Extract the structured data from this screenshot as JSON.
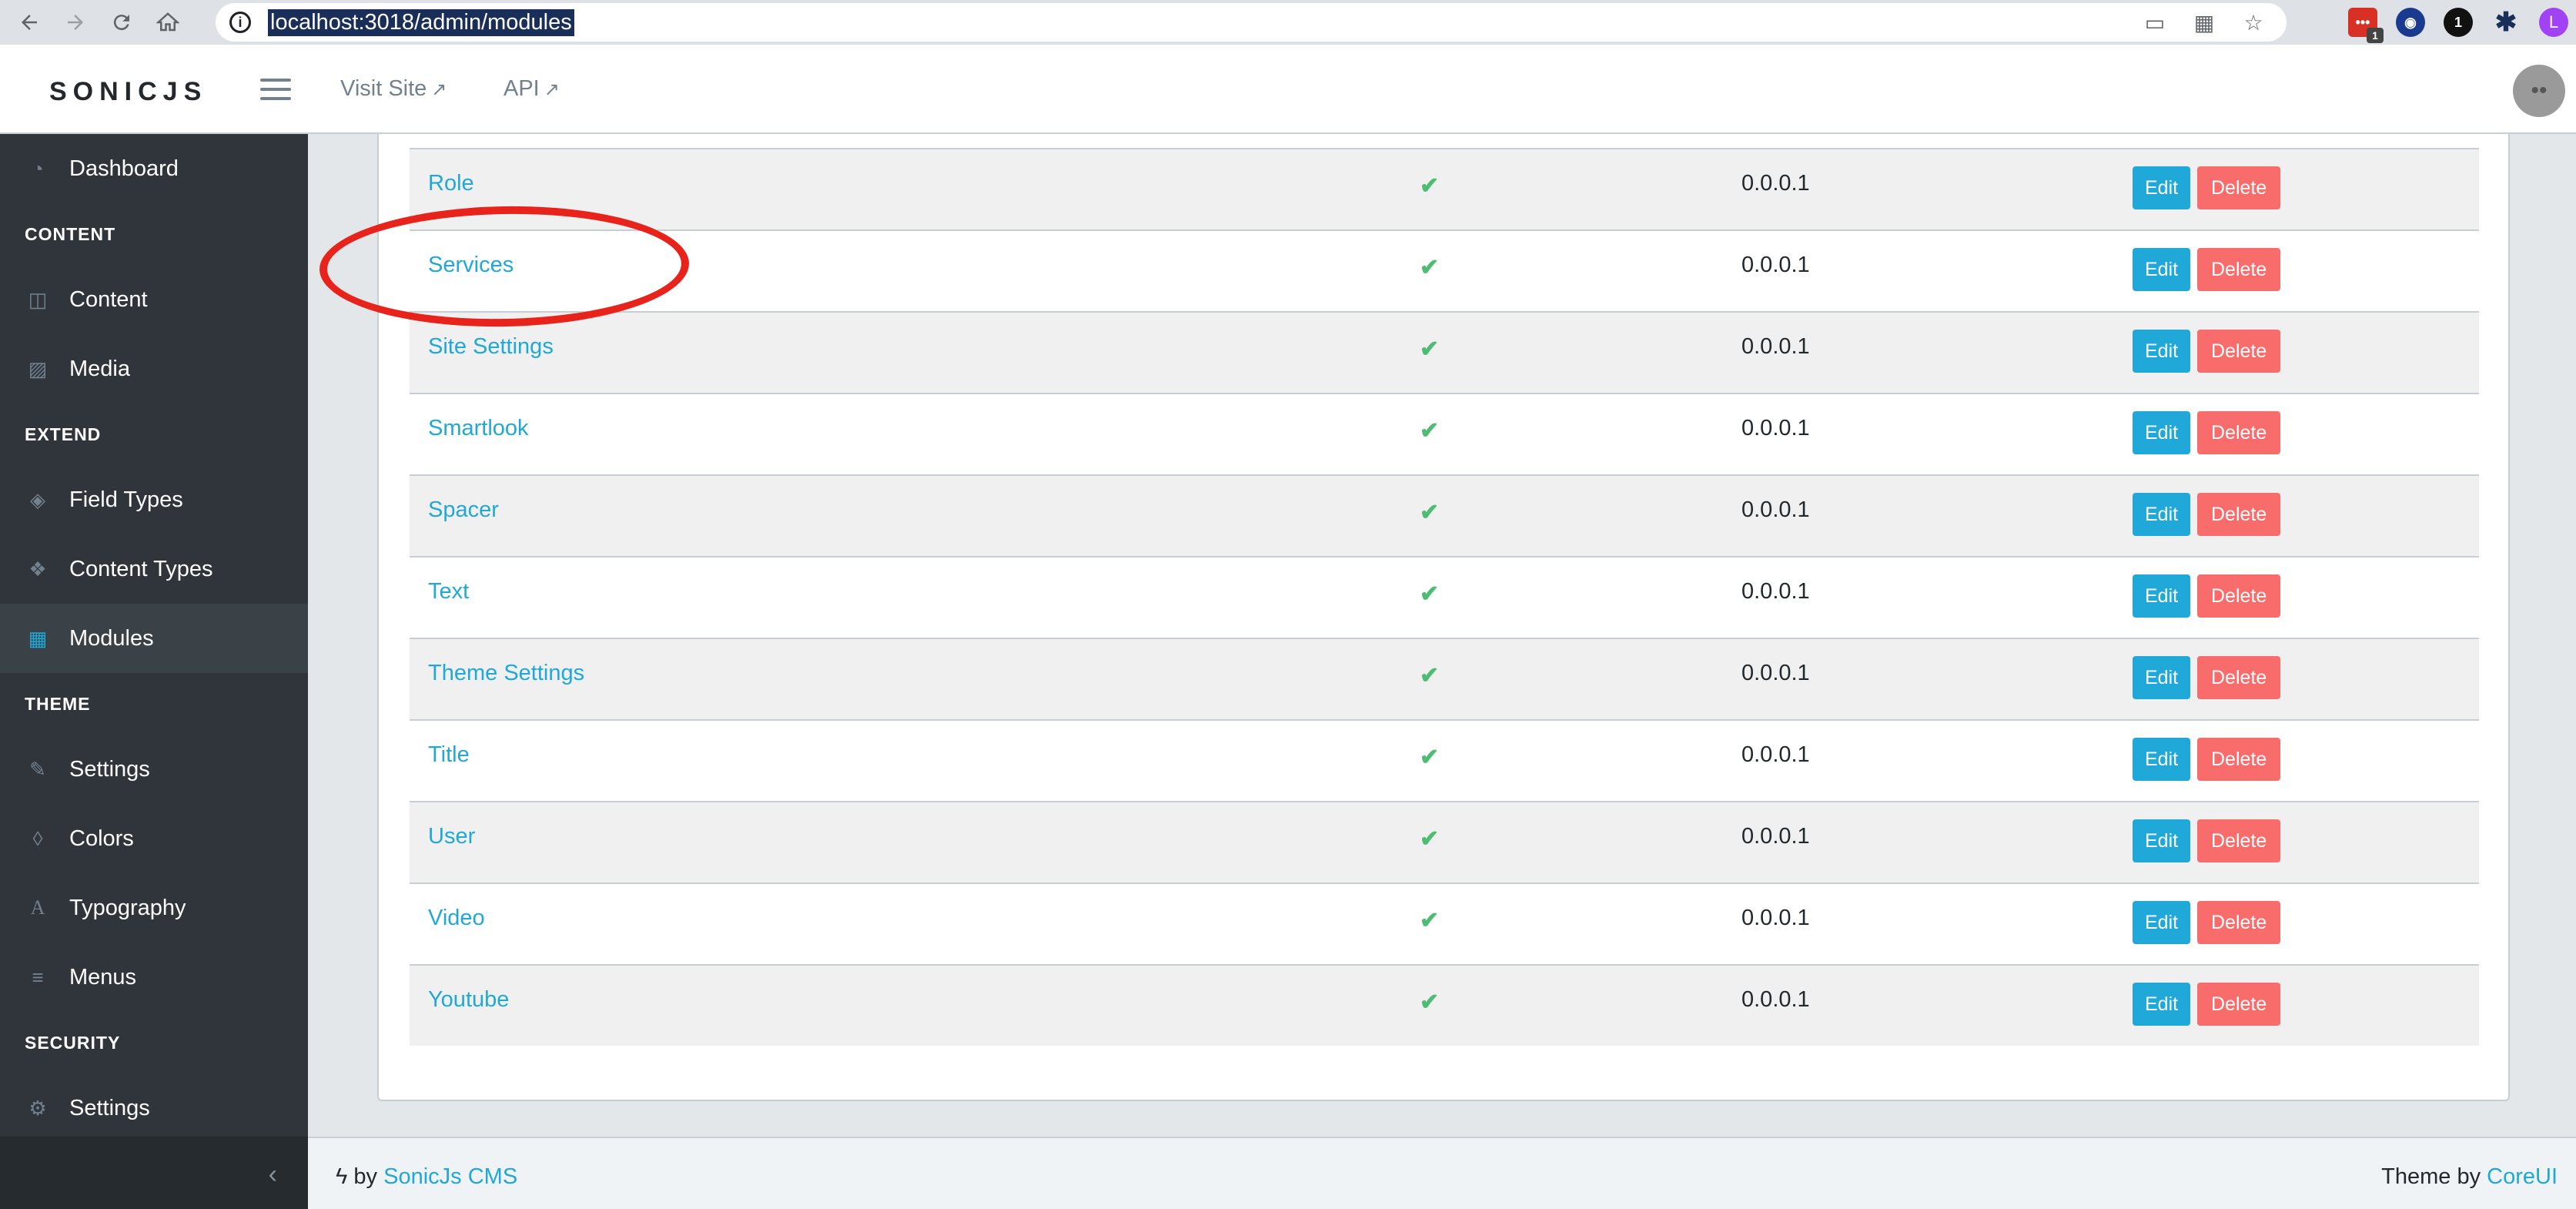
{
  "browser": {
    "url": "localhost:3018/admin/modules",
    "ext_badge": "1",
    "ext_black": "1",
    "profile_initial": "L"
  },
  "header": {
    "logo": "SONICJS",
    "visit_site": "Visit Site",
    "api": "API"
  },
  "sidebar": {
    "items": [
      {
        "label": "Dashboard",
        "icon": "speedometer-icon"
      },
      {
        "section": "CONTENT"
      },
      {
        "label": "Content",
        "icon": "columns-icon"
      },
      {
        "label": "Media",
        "icon": "image-icon"
      },
      {
        "section": "EXTEND"
      },
      {
        "label": "Field Types",
        "icon": "cube-icon"
      },
      {
        "label": "Content Types",
        "icon": "cubes-icon"
      },
      {
        "label": "Modules",
        "icon": "grid-icon",
        "active": true
      },
      {
        "section": "THEME"
      },
      {
        "label": "Settings",
        "icon": "brush-icon"
      },
      {
        "label": "Colors",
        "icon": "drop-icon"
      },
      {
        "label": "Typography",
        "icon": "font-icon"
      },
      {
        "label": "Menus",
        "icon": "menu-icon"
      },
      {
        "section": "SECURITY"
      },
      {
        "label": "Settings",
        "icon": "gear-icon"
      }
    ]
  },
  "table": {
    "edit_label": "Edit",
    "delete_label": "Delete",
    "rows": [
      {
        "name": "Role",
        "enabled": "✔",
        "version": "0.0.0.1"
      },
      {
        "name": "Services",
        "enabled": "✔",
        "version": "0.0.0.1"
      },
      {
        "name": "Site Settings",
        "enabled": "✔",
        "version": "0.0.0.1"
      },
      {
        "name": "Smartlook",
        "enabled": "✔",
        "version": "0.0.0.1"
      },
      {
        "name": "Spacer",
        "enabled": "✔",
        "version": "0.0.0.1"
      },
      {
        "name": "Text",
        "enabled": "✔",
        "version": "0.0.0.1"
      },
      {
        "name": "Theme Settings",
        "enabled": "✔",
        "version": "0.0.0.1"
      },
      {
        "name": "Title",
        "enabled": "✔",
        "version": "0.0.0.1"
      },
      {
        "name": "User",
        "enabled": "✔",
        "version": "0.0.0.1"
      },
      {
        "name": "Video",
        "enabled": "✔",
        "version": "0.0.0.1"
      },
      {
        "name": "Youtube",
        "enabled": "✔",
        "version": "0.0.0.1"
      }
    ]
  },
  "footer": {
    "by": "by",
    "cms_link": "SonicJs CMS",
    "theme_by": "Theme by",
    "coreui_link": "CoreUI"
  },
  "colors": {
    "accent": "#20a8d8",
    "danger": "#f86c6b",
    "success": "#4dbd74",
    "sidebar": "#2f353a",
    "annotation": "#e8231b"
  }
}
